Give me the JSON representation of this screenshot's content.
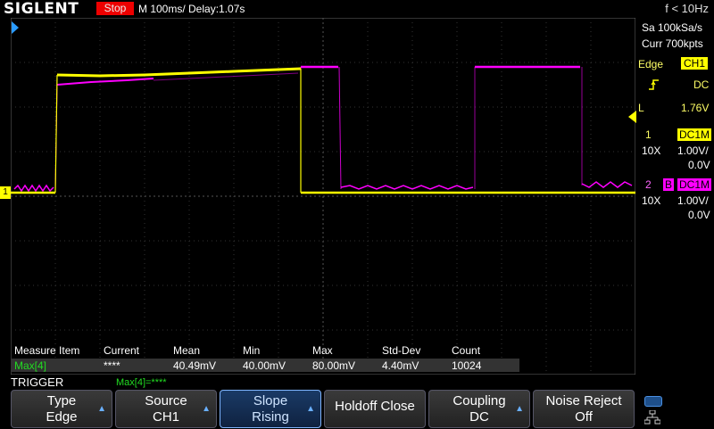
{
  "topbar": {
    "brand": "SIGLENT",
    "status": "Stop",
    "timebase": "M 100ms/  Delay:1.07s",
    "freq": "f < 10Hz"
  },
  "side": {
    "sa": "Sa 100kSa/s",
    "curr": "Curr 700kpts",
    "edge_label": "Edge",
    "edge_source": "CH1",
    "coupling": "DC",
    "level_label": "L",
    "level_value": "1.76V",
    "ch1": {
      "num": "1",
      "coupling": "DC1M",
      "probe": "10X",
      "scale": "1.00V/",
      "offset": "0.0V"
    },
    "ch2": {
      "num": "2",
      "bw": "B",
      "coupling": "DC1M",
      "probe": "10X",
      "scale": "1.00V/",
      "offset": "0.0V"
    }
  },
  "measure": {
    "headers": [
      "Measure Item",
      "Current",
      "Mean",
      "Min",
      "Max",
      "Std-Dev",
      "Count"
    ],
    "row": [
      "Max[4]",
      "****",
      "40.49mV",
      "40.00mV",
      "80.00mV",
      "4.40mV",
      "10024"
    ]
  },
  "trigger": {
    "label": "TRIGGER",
    "max": "Max[4]=****"
  },
  "menu": [
    {
      "top": "Type",
      "bottom": "Edge"
    },
    {
      "top": "Source",
      "bottom": "CH1"
    },
    {
      "top": "Slope",
      "bottom": "Rising"
    },
    {
      "top": "Holdoff Close",
      "bottom": ""
    },
    {
      "top": "Coupling",
      "bottom": "DC"
    },
    {
      "top": "Noise Reject",
      "bottom": "Off"
    }
  ],
  "markers": {
    "ch1_marker": "1"
  },
  "colors": {
    "ch1": "#ffff00",
    "ch2": "#ff00ff",
    "grid": "#3a3a3a"
  }
}
